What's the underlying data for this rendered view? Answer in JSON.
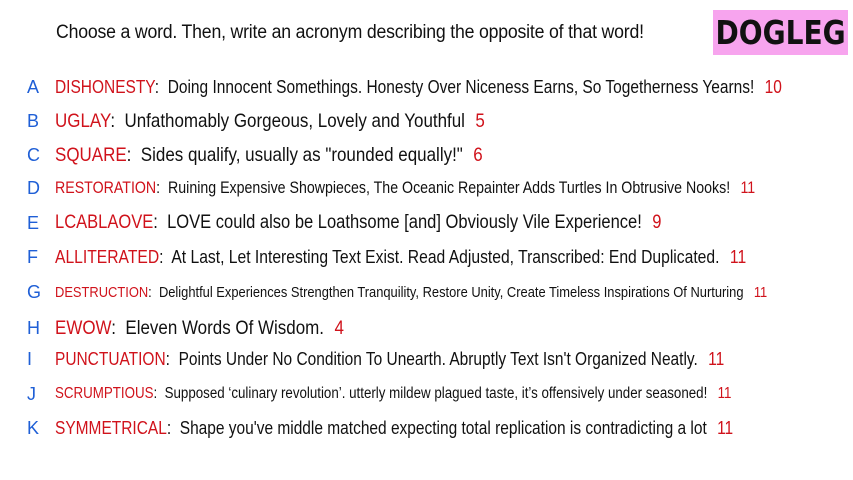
{
  "prompt": "Choose a word. Then, write an acronym describing the opposite of that word!",
  "logo_text": "DOGLEG",
  "colors": {
    "logo_bg": "#f7a4ee",
    "letter": "#1f5fd6",
    "word": "#d0121b",
    "count": "#d0121b"
  },
  "entries": [
    {
      "letter": "A",
      "word": "DISHONESTY",
      "definition": "Doing Innocent Somethings. Honesty Over Niceness Earns, So Togetherness Yearns!",
      "count": "10"
    },
    {
      "letter": "B",
      "word": "UGLAY",
      "definition": "Unfathomably Gorgeous, Lovely and Youthful",
      "count": "5"
    },
    {
      "letter": "C",
      "word": "SQUARE",
      "definition": "Sides qualify, usually as \"rounded equally!\"",
      "count": "6"
    },
    {
      "letter": "D",
      "word": "RESTORATION",
      "definition": "Ruining Expensive Showpieces, The Oceanic Repainter Adds Turtles In Obtrusive Nooks!",
      "count": "11"
    },
    {
      "letter": "E",
      "word": "LCABLAOVE",
      "definition": "LOVE could also be Loathsome [and] Obviously Vile Experience!",
      "count": "9"
    },
    {
      "letter": "F",
      "word": "ALLITERATED",
      "definition": "At Last, Let Interesting Text Exist. Read Adjusted, Transcribed: End Duplicated.",
      "count": "11"
    },
    {
      "letter": "G",
      "word": "DESTRUCTION",
      "definition": "Delightful Experiences Strengthen Tranquility, Restore Unity, Create Timeless Inspirations Of Nurturing",
      "count": "11"
    },
    {
      "letter": "H",
      "word": "EWOW",
      "definition": "Eleven Words Of Wisdom.",
      "count": "4"
    },
    {
      "letter": "I",
      "word": "PUNCTUATION",
      "definition": "Points Under No Condition To Unearth. Abruptly Text Isn't Organized Neatly.",
      "count": "11"
    },
    {
      "letter": "J",
      "word": "SCRUMPTIOUS",
      "definition": "Supposed ‘culinary revolution’. utterly mildew plagued taste, it’s offensively under seasoned!",
      "count": "11"
    },
    {
      "letter": "K",
      "word": "SYMMETRICAL",
      "definition": "Shape you've middle matched expecting total replication is contradicting a lot",
      "count": "11"
    }
  ]
}
